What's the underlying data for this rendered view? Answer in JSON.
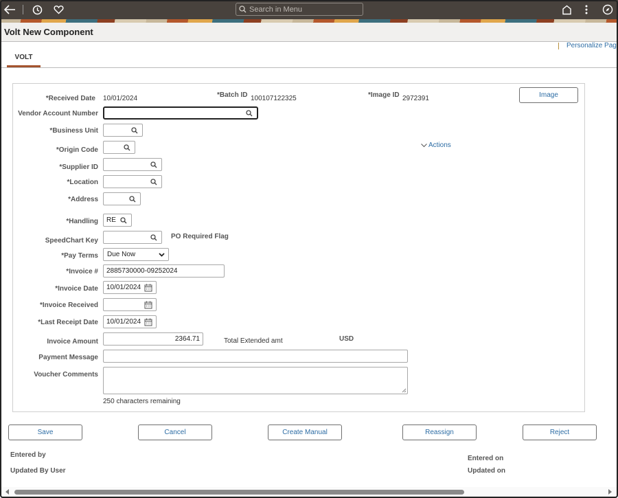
{
  "topbar": {
    "icons": [
      "back-arrow-icon",
      "history-icon",
      "favorites-heart-icon",
      "home-icon",
      "more-menu-icon",
      "navigator-compass-icon"
    ],
    "search_placeholder": "Search in Menu"
  },
  "page": {
    "title": "Volt New Component",
    "personalize_link": "Personalize Page",
    "tabs": [
      {
        "label": "VOLT",
        "active": true
      }
    ]
  },
  "form": {
    "received_date": {
      "label": "*Received Date",
      "value": "10/01/2024"
    },
    "batch_id": {
      "label": "*Batch ID",
      "value": "100107122325"
    },
    "image_id": {
      "label": "*Image ID",
      "value": "2972391"
    },
    "image_button": "Image",
    "vendor_account_number": {
      "label": "Vendor Account Number",
      "value": ""
    },
    "business_unit": {
      "label": "*Business Unit",
      "value": ""
    },
    "origin_code": {
      "label": "*Origin Code",
      "value": ""
    },
    "actions_link": "Actions",
    "supplier_id": {
      "label": "*Supplier ID",
      "value": ""
    },
    "location": {
      "label": "*Location",
      "value": ""
    },
    "address": {
      "label": "*Address",
      "value": ""
    },
    "handling": {
      "label": "*Handling",
      "value": "RE"
    },
    "speedchart_key": {
      "label": "SpeedChart Key",
      "value": ""
    },
    "po_required_flag": "PO Required Flag",
    "pay_terms": {
      "label": "*Pay Terms",
      "value": "Due Now"
    },
    "invoice_number": {
      "label": "*Invoice #",
      "value": "2885730000-09252024"
    },
    "invoice_date": {
      "label": "*Invoice Date",
      "value": "10/01/2024"
    },
    "invoice_received": {
      "label": "*Invoice Received",
      "value": ""
    },
    "last_receipt_date": {
      "label": "*Last Receipt Date",
      "value": "10/01/2024"
    },
    "invoice_amount": {
      "label": "Invoice Amount",
      "value": "2364.71"
    },
    "total_extended_amt": "Total Extended amt",
    "currency": "USD",
    "payment_message": {
      "label": "Payment Message",
      "value": ""
    },
    "voucher_comments": {
      "label": "Voucher Comments",
      "value": ""
    },
    "chars_remaining": "250 characters remaining"
  },
  "buttons": {
    "save": "Save",
    "cancel": "Cancel",
    "create_manual": "Create Manual",
    "reassign": "Reassign",
    "reject": "Reject"
  },
  "footer": {
    "entered_by": "Entered by",
    "updated_by_user": "Updated By User",
    "entered_on": "Entered on",
    "updated_on": "Updated on"
  }
}
